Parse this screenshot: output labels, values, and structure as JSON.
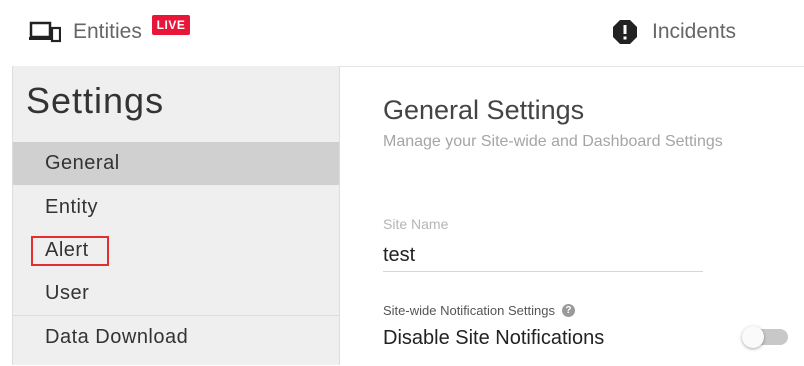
{
  "nav": {
    "entities_label": "Entities",
    "entities_icon": "devices-icon",
    "live_badge": "LIVE",
    "live_badge_color": "#e8173a",
    "incidents_label": "Incidents",
    "incidents_icon": "alert-octagon-icon"
  },
  "sidebar": {
    "title": "Settings",
    "items": [
      {
        "label": "General",
        "active": true
      },
      {
        "label": "Entity",
        "active": false
      },
      {
        "label": "Alert",
        "active": false,
        "highlighted": true,
        "highlight_color": "#e03030"
      },
      {
        "label": "User",
        "active": false
      },
      {
        "label": "Data Download",
        "active": false
      }
    ]
  },
  "main": {
    "title": "General Settings",
    "subtitle": "Manage your Site-wide and Dashboard Settings",
    "site_name_label": "Site Name",
    "site_name_value": "test",
    "notification_section_label": "Site-wide Notification Settings",
    "help_icon_glyph": "?",
    "disable_notifications_label": "Disable Site Notifications",
    "disable_notifications_on": false
  }
}
